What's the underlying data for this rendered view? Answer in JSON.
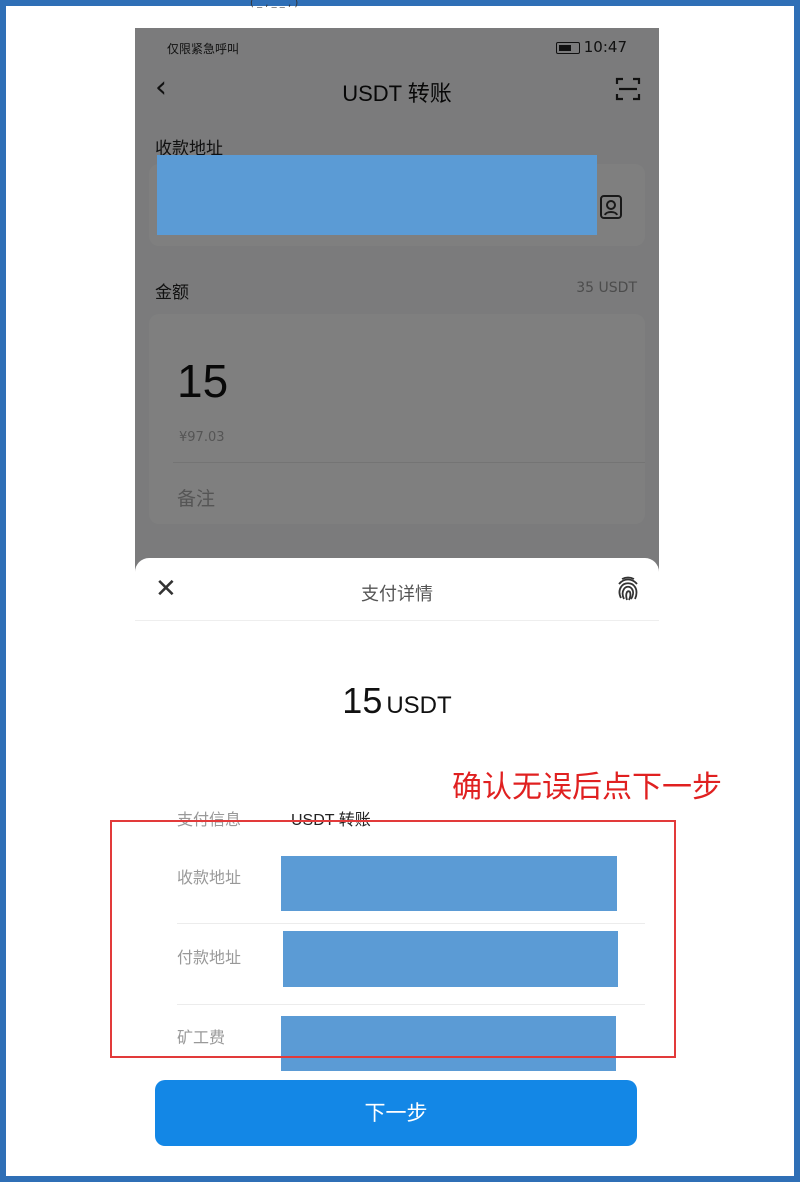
{
  "top_crop_text": "( _ , _ _ , )",
  "status_bar": {
    "left_text": "仅限紧急呼叫",
    "time": "10:47"
  },
  "header": {
    "title": "USDT 转账"
  },
  "form": {
    "address_label": "收款地址",
    "amount_label": "金额",
    "balance": "35 USDT",
    "amount_value": "15",
    "fiat_value": "¥97.03",
    "note_placeholder": "备注"
  },
  "sheet": {
    "title": "支付详情",
    "amount": "15",
    "unit": "USDT",
    "rows": [
      {
        "label": "支付信息",
        "value": "USDT 转账"
      },
      {
        "label": "收款地址",
        "value": ""
      },
      {
        "label": "付款地址",
        "value": ""
      },
      {
        "label": "矿工费",
        "value": ""
      }
    ],
    "next_button": "下一步"
  },
  "annotation": {
    "text": "确认无误后点下一步",
    "color": "#e02020"
  },
  "colors": {
    "frame": "#2f6fb6",
    "button": "#1387e6",
    "redaction": "#5b9bd5",
    "annotation_box": "#e23a3a"
  },
  "icons": [
    "back-icon",
    "scan-icon",
    "contact-icon",
    "close-icon",
    "fingerprint-icon",
    "battery-icon"
  ]
}
